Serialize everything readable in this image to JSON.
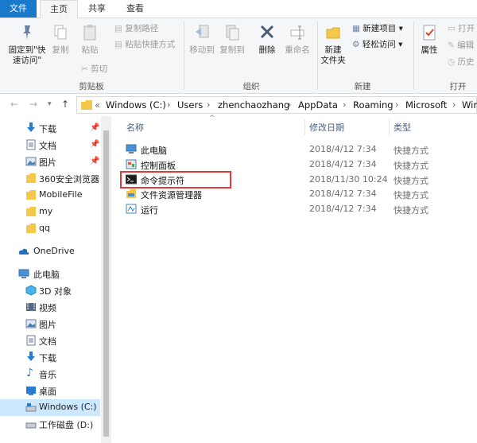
{
  "tabs": [
    "文件",
    "主页",
    "共享",
    "查看"
  ],
  "ribbon": {
    "clipboard": {
      "pin_label_1": "固定到\"快",
      "pin_label_2": "速访问\"",
      "copy": "复制",
      "paste": "粘贴",
      "copy_path": "复制路径",
      "paste_shortcut": "粘贴快捷方式",
      "cut": "剪切",
      "group": "剪贴板"
    },
    "organize": {
      "move_to": "移动到",
      "copy_to": "复制到",
      "delete": "删除",
      "rename": "重命名",
      "group": "组织"
    },
    "new": {
      "new_folder_1": "新建",
      "new_folder_2": "文件夹",
      "new_item": "新建项目",
      "easy_access": "轻松访问",
      "group": "新建"
    },
    "open": {
      "properties": "属性",
      "open": "打开",
      "edit": "编辑",
      "history": "历史",
      "group": "打开"
    }
  },
  "address": {
    "overflow": "«",
    "crumbs": [
      "Windows (C:)",
      "Users",
      "zhenchaozhang",
      "AppData",
      "Roaming",
      "Microsoft",
      "Win"
    ]
  },
  "sidebar": {
    "items": [
      {
        "label": "下载",
        "icon": "download-icon",
        "pinned": true
      },
      {
        "label": "文档",
        "icon": "document-icon",
        "pinned": true
      },
      {
        "label": "图片",
        "icon": "picture-icon",
        "pinned": true
      },
      {
        "label": "360安全浏览器",
        "icon": "folder-icon"
      },
      {
        "label": "MobileFile",
        "icon": "folder-icon"
      },
      {
        "label": "my",
        "icon": "folder-icon"
      },
      {
        "label": "qq",
        "icon": "folder-icon"
      },
      {
        "label": "OneDrive",
        "icon": "cloud-icon"
      },
      {
        "label": "此电脑",
        "icon": "computer-icon"
      },
      {
        "label": "3D 对象",
        "icon": "cube-icon"
      },
      {
        "label": "视频",
        "icon": "video-icon"
      },
      {
        "label": "图片",
        "icon": "picture-icon"
      },
      {
        "label": "文档",
        "icon": "document-icon"
      },
      {
        "label": "下载",
        "icon": "download-icon"
      },
      {
        "label": "音乐",
        "icon": "music-icon"
      },
      {
        "label": "桌面",
        "icon": "desktop-icon"
      },
      {
        "label": "Windows (C:)",
        "icon": "drive-icon",
        "selected": true
      },
      {
        "label": "工作磁盘 (D:)",
        "icon": "drive-icon"
      }
    ]
  },
  "columns": {
    "name": "名称",
    "date": "修改日期",
    "type": "类型"
  },
  "files": [
    {
      "name": "此电脑",
      "date": "2018/4/12 7:34",
      "type": "快捷方式",
      "icon": "computer-shortcut-icon"
    },
    {
      "name": "控制面板",
      "date": "2018/4/12 7:34",
      "type": "快捷方式",
      "icon": "control-panel-shortcut-icon"
    },
    {
      "name": "命令提示符",
      "date": "2018/11/30 10:24",
      "type": "快捷方式",
      "icon": "command-prompt-shortcut-icon"
    },
    {
      "name": "文件资源管理器",
      "date": "2018/4/12 7:34",
      "type": "快捷方式",
      "icon": "explorer-shortcut-icon"
    },
    {
      "name": "运行",
      "date": "2018/4/12 7:34",
      "type": "快捷方式",
      "icon": "run-shortcut-icon"
    }
  ],
  "colors": {
    "file_tab": "#1979ca",
    "selection": "#cce8ff",
    "highlight_box": "#e03a3a"
  }
}
